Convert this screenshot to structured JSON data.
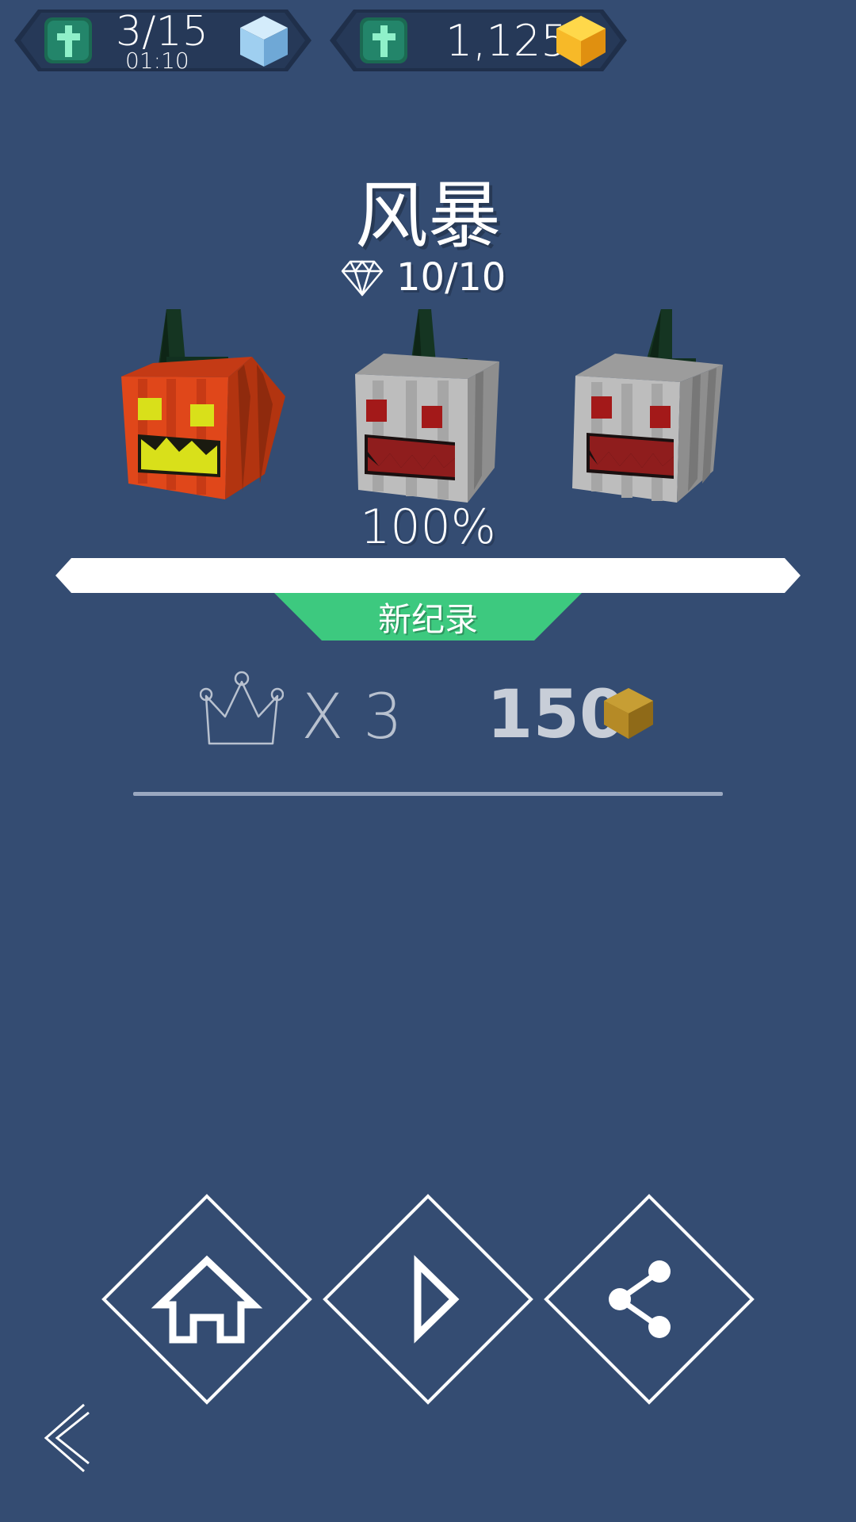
{
  "hud": {
    "lives_display": "3/15",
    "lives_timer": "01:10",
    "coins": "1,125"
  },
  "level": {
    "title": "风暴",
    "gems": "10/10",
    "progress_label": "100%",
    "progress_value": 1.0,
    "record_badge": "新纪录"
  },
  "reward": {
    "multiplier": "X 3",
    "coins": "150"
  },
  "colors": {
    "background": "#344c72",
    "badge_green": "#3dc97f",
    "coin_gold": "#f7b928",
    "pumpkin_orange": "#e0471a",
    "pumpkin_gray": "#a9a9a9"
  },
  "icons": [
    "cross-icon",
    "cube-icon",
    "coin-icon",
    "diamond-icon",
    "crown-icon",
    "home-icon",
    "play-icon",
    "share-icon",
    "back-icon"
  ]
}
